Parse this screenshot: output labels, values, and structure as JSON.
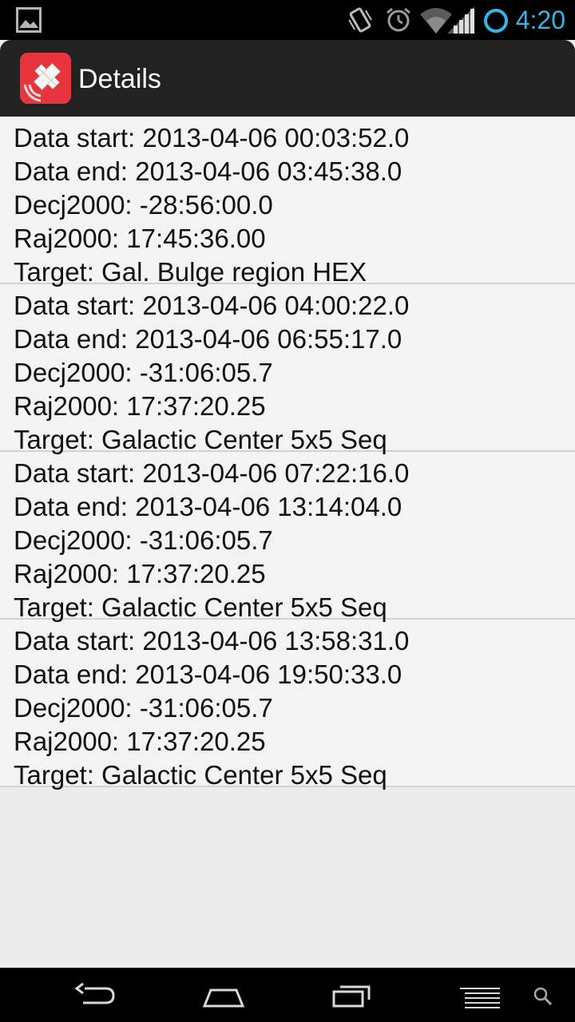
{
  "status_bar": {
    "time": "4:20",
    "icons": [
      "picture-notification-icon",
      "vibrate-icon",
      "alarm-icon",
      "wifi-icon",
      "signal-icon",
      "battery-circle-icon"
    ],
    "accent_color": "#33b5e5"
  },
  "action_bar": {
    "title": "Details",
    "icon": "satellite-app-icon",
    "icon_color": "#e8343d"
  },
  "entries": [
    {
      "data_start": "Data start: 2013-04-06 00:03:52.0",
      "data_end": "Data end: 2013-04-06 03:45:38.0",
      "decj2000": "Decj2000: -28:56:00.0",
      "raj2000": "Raj2000: 17:45:36.00",
      "target": "Target: Gal. Bulge region HEX"
    },
    {
      "data_start": "Data start: 2013-04-06 04:00:22.0",
      "data_end": "Data end: 2013-04-06 06:55:17.0",
      "decj2000": "Decj2000: -31:06:05.7",
      "raj2000": "Raj2000: 17:37:20.25",
      "target": "Target: Galactic Center 5x5 Seq"
    },
    {
      "data_start": "Data start: 2013-04-06 07:22:16.0",
      "data_end": "Data end: 2013-04-06 13:14:04.0",
      "decj2000": "Decj2000: -31:06:05.7",
      "raj2000": "Raj2000: 17:37:20.25",
      "target": "Target: Galactic Center 5x5 Seq"
    },
    {
      "data_start": "Data start: 2013-04-06 13:58:31.0",
      "data_end": "Data end: 2013-04-06 19:50:33.0",
      "decj2000": "Decj2000: -31:06:05.7",
      "raj2000": "Raj2000: 17:37:20.25",
      "target": "Target: Galactic Center 5x5 Seq"
    }
  ],
  "nav_bar": {
    "buttons": [
      "back-icon",
      "home-icon",
      "recent-apps-icon",
      "menu-icon",
      "search-icon"
    ]
  }
}
